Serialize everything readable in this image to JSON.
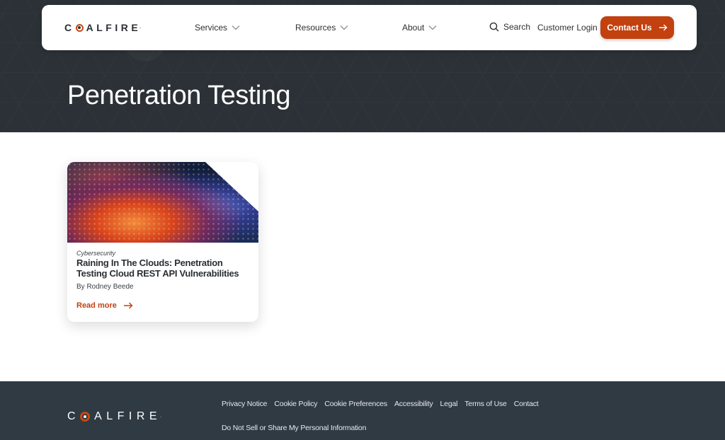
{
  "brand": {
    "logo_text_pre": "C",
    "logo_text_post": "ALFIRE",
    "accent_color": "#c2410f"
  },
  "nav": {
    "items": [
      {
        "label": "Services"
      },
      {
        "label": "Resources"
      },
      {
        "label": "About"
      }
    ],
    "search_label": "Search",
    "login_label": "Customer Login",
    "contact_label": "Contact Us"
  },
  "hero": {
    "title": "Penetration Testing"
  },
  "card": {
    "category": "Cybersecurity",
    "title": "Raining In The Clouds: Penetration Testing Cloud REST API Vulnerabilities",
    "author": "By Rodney Beede",
    "read_more": "Read more"
  },
  "footer": {
    "links": [
      "Privacy Notice",
      "Cookie Policy",
      "Cookie Preferences",
      "Accessibility",
      "Legal",
      "Terms of Use",
      "Contact"
    ],
    "secondary_link": "Do Not Sell or Share My Personal Information"
  }
}
